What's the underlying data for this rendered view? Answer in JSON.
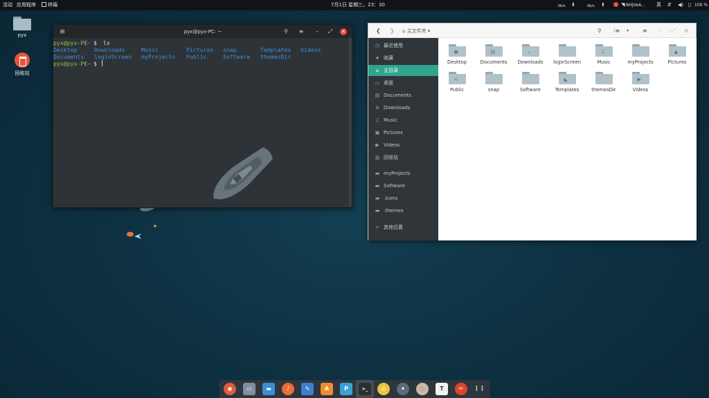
{
  "topbar": {
    "activities": "活动",
    "apps_menu": "应用程序",
    "active_app": "终端",
    "clock": "7月1日 星期三，23：30",
    "net_down": "0b/s",
    "net_up": "0b/s",
    "network_name": "NHJVeA...",
    "input_method": "英",
    "battery": "100 %"
  },
  "desktop": {
    "home_icon_label": "pyx",
    "trash_icon_label": "回收站"
  },
  "terminal": {
    "title": "pyx@pyx-PC: ~",
    "prompt_user": "pyx@pyx-PC",
    "prompt_sep": ":",
    "prompt_path": "~",
    "prompt_sym": "$",
    "command": "ls",
    "ls_row1": [
      "Desktop",
      "Downloads",
      "Music",
      "Pictures",
      "snap",
      "Templates",
      "Videos"
    ],
    "ls_row2": [
      "Documents",
      "loginScreen",
      "myProjects",
      "Public",
      "Software",
      "themesDir"
    ]
  },
  "files": {
    "location": "主文件夹",
    "sidebar": [
      {
        "icon": "recent-icon",
        "label": "最近使用"
      },
      {
        "icon": "star-icon",
        "label": "收藏"
      },
      {
        "icon": "home-icon",
        "label": "主目录"
      },
      {
        "icon": "desktop-icon",
        "label": "桌面"
      },
      {
        "icon": "document-icon",
        "label": "Documents"
      },
      {
        "icon": "download-icon",
        "label": "Downloads"
      },
      {
        "icon": "music-icon",
        "label": "Music"
      },
      {
        "icon": "picture-icon",
        "label": "Pictures"
      },
      {
        "icon": "video-icon",
        "label": "Videos"
      },
      {
        "icon": "trash-icon",
        "label": "回收站"
      },
      {
        "icon": "folder-icon",
        "label": "myProjects"
      },
      {
        "icon": "folder-icon",
        "label": "Software"
      },
      {
        "icon": "folder-icon",
        "label": ".icons"
      },
      {
        "icon": "folder-icon",
        "label": ".themes"
      },
      {
        "icon": "plus-icon",
        "label": "其他位置"
      }
    ],
    "items": [
      {
        "name": "Desktop",
        "glyph": "▣"
      },
      {
        "name": "Documents",
        "glyph": "▤"
      },
      {
        "name": "Downloads",
        "glyph": "⌄"
      },
      {
        "name": "loginScreen",
        "glyph": ""
      },
      {
        "name": "Music",
        "glyph": "♫"
      },
      {
        "name": "myProjects",
        "glyph": ""
      },
      {
        "name": "Pictures",
        "glyph": "▲"
      },
      {
        "name": "Public",
        "glyph": "<"
      },
      {
        "name": "snap",
        "glyph": ""
      },
      {
        "name": "Software",
        "glyph": ""
      },
      {
        "name": "Templates",
        "glyph": "◣"
      },
      {
        "name": "themesDir",
        "glyph": ""
      },
      {
        "name": "Videos",
        "glyph": "▶"
      }
    ]
  },
  "dock": {
    "apps": [
      {
        "name": "gitkraken",
        "color": "#e05a3e",
        "glyph": "◉"
      },
      {
        "name": "file-roller",
        "color": "#7d8fa0",
        "glyph": "▭"
      },
      {
        "name": "files",
        "color": "#3a8fd6",
        "glyph": "▬"
      },
      {
        "name": "music-player",
        "color": "#f06a3a",
        "glyph": "♪"
      },
      {
        "name": "text-editor",
        "color": "#3f7fd1",
        "glyph": "✎"
      },
      {
        "name": "software-center",
        "color": "#f08c2a",
        "glyph": "A"
      },
      {
        "name": "pycharm",
        "color": "#3aa0d8",
        "glyph": "P"
      },
      {
        "name": "terminal",
        "color": "#2b2f33",
        "glyph": ">_"
      },
      {
        "name": "chrome",
        "color": "#e8c53a",
        "glyph": "◎"
      },
      {
        "name": "inkscape",
        "color": "#5c6c7a",
        "glyph": "✦"
      },
      {
        "name": "shell-app",
        "color": "#c9b8a3",
        "glyph": "◌"
      },
      {
        "name": "typora",
        "color": "#f2f2f2",
        "glyph": "T"
      },
      {
        "name": "screenshot",
        "color": "#d9462c",
        "glyph": "✂"
      },
      {
        "name": "show-apps",
        "color": "transparent",
        "glyph": "⋮⋮"
      }
    ]
  }
}
